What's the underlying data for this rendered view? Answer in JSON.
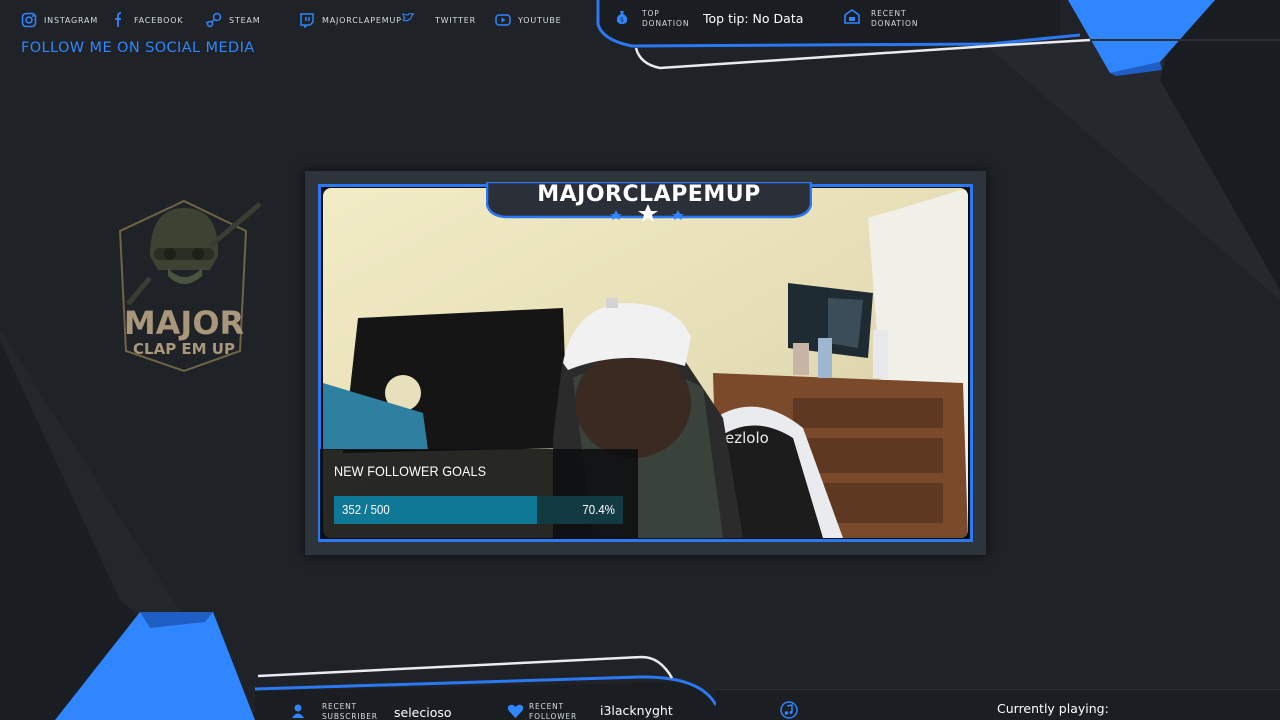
{
  "social": {
    "heading": "FOLLOW ME ON SOCIAL MEDIA",
    "items": [
      {
        "label": "INSTAGRAM",
        "icon": "instagram-icon"
      },
      {
        "label": "FACEBOOK",
        "icon": "facebook-icon"
      },
      {
        "label": "STEAM",
        "icon": "steam-icon"
      },
      {
        "label": "MAJORCLAPEMUP",
        "icon": "twitch-icon"
      },
      {
        "label": "TWITTER",
        "icon": "twitter-icon"
      },
      {
        "label": "YOUTUBE",
        "icon": "youtube-icon"
      }
    ]
  },
  "donation": {
    "top_label": "TOP DONATION",
    "top_label_line1": "TOP",
    "top_label_line2": "DONATION",
    "top_value": "Top tip: No Data",
    "recent_label_line1": "RECENT",
    "recent_label_line2": "DONATION"
  },
  "logo": {
    "line1": "MAJOR",
    "line2": "CLAP EM UP"
  },
  "camera": {
    "channel_name": "MAJORCLAPEMUP",
    "chair_brand": "ezlolo"
  },
  "goal": {
    "title": "NEW FOLLOWER GOALS",
    "current": 352,
    "target": 500,
    "count_text": "352 / 500",
    "percent_text": "70.4%",
    "progress": 0.704
  },
  "bottom": {
    "subscriber_label_line1": "RECENT",
    "subscriber_label_line2": "SUBSCRIBER",
    "subscriber_value": "selecioso",
    "follower_label_line1": "RECENT",
    "follower_label_line2": "FOLLOWER",
    "follower_value": "i3lacknyght",
    "now_playing": "Currently playing:"
  },
  "colors": {
    "accent_blue": "#2a79f2",
    "bright_blue": "#2f86ff",
    "background": "#1e2125",
    "goal_fill": "#0e7896"
  }
}
